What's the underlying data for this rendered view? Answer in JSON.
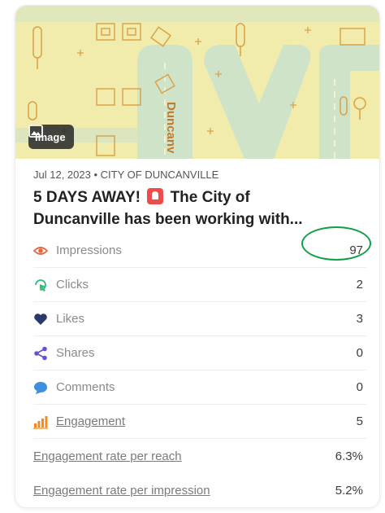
{
  "post": {
    "image_badge": "Image",
    "date": "Jul 12, 2023",
    "separator": "•",
    "source": "CITY OF DUNCANVILLE",
    "title_line1_a": "5 DAYS AWAY!",
    "title_line1_b": "The City of",
    "title_line2": "Duncanville has been working with...",
    "hero_text": "Duncanv"
  },
  "metrics": [
    {
      "label": "Impressions",
      "value": "97",
      "icon": "eye-icon",
      "color": "#e8663d"
    },
    {
      "label": "Clicks",
      "value": "2",
      "icon": "click-icon",
      "color": "#2dbf7a"
    },
    {
      "label": "Likes",
      "value": "3",
      "icon": "heart-icon",
      "color": "#2b3a6b"
    },
    {
      "label": "Shares",
      "value": "0",
      "icon": "share-icon",
      "color": "#6a4fd8"
    },
    {
      "label": "Comments",
      "value": "0",
      "icon": "comment-icon",
      "color": "#3d8fe0"
    },
    {
      "label": "Engagement",
      "value": "5",
      "icon": "bar-chart-icon",
      "color": "#f08a24"
    }
  ],
  "rates": [
    {
      "label": "Engagement rate per reach",
      "value": "6.3%"
    },
    {
      "label": "Engagement rate per impression",
      "value": "5.2%"
    }
  ],
  "colors": {
    "hero_bg": "#f1ecac",
    "hero_road": "#cfe3c9",
    "highlight_circle": "#11a04a"
  }
}
